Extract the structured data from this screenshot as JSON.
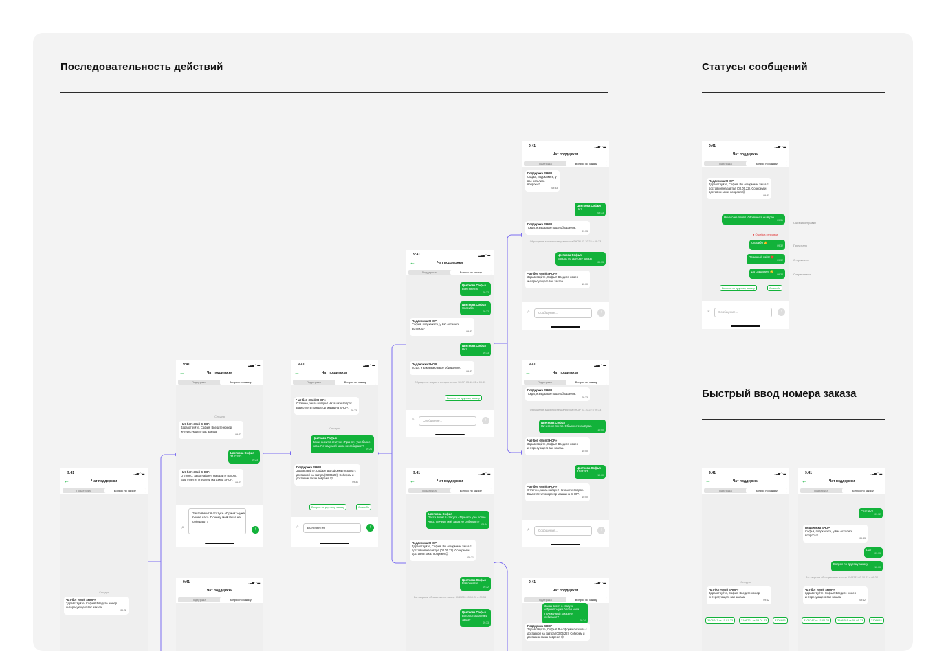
{
  "headings": {
    "sequence": "Последовательность действий",
    "statuses": "Статусы сообщений",
    "quick_input": "Быстрый ввод номера заказа"
  },
  "common": {
    "time": "9:41",
    "chat_title": "Чат поддержки",
    "tab_support": "Поддержка",
    "tab_order": "Вопрос по заказу",
    "placeholder": "Сообщение...",
    "bot": "Чат-бот «Мой SHOP»",
    "support": "Поддержка SHOP",
    "user": "Цветкова Софья",
    "today": "Сегодня",
    "q_other": "Вопрос по другому заказу",
    "thanks": "Спасибо"
  },
  "msgs": {
    "hello_bot": "Здравствуйте, Софья! Введите номер интересующего вас заказа.",
    "bot_found": "Отлично, заказ найден! Наташите вопрос. Вам ответит оператор магазина SHOP.",
    "user_hang": "Заказ висит в статусе «Принят» уже более часа. Почему мой заказ не собирают?",
    "support_hello": "Здравствуйте, Софья! Вы оформили заказ с доставкой на завтра (03.05.22). Соберем и доставим заказ вовремя 😉",
    "understood": "Всё понятно",
    "thanks_msg": "Спасибо!",
    "no": "Нет",
    "any_more": "Софья, подскажите, у вас остались вопросы?",
    "closing": "Тогда, я закрываю ваше обращение.",
    "closed_sys": "Обращение закрыто специалистом SHOP 03.10.22 в 09:33",
    "user_closed_sys": "Вы закрыли обращение по заказу 3143283 03.10.22 в 09:34",
    "not_clear": "Ничего не понял. Объясните ещё раз.",
    "another_order": "Вопрос по другому заказу",
    "order_num": "3143283",
    "order_chip": "3106747 от 11.01.23",
    "order_chip2": "3106701 от 09.01.23",
    "order_chip3": "3106693",
    "like": "Спасибо 👍",
    "nice": "Отличный сайт! ❤️",
    "bye": "До свидания! 🙂",
    "empty_field": "Напишите…"
  },
  "status_labels": {
    "error": "Ошибка отправки",
    "received": "Прочитано",
    "sent": "Отправлено",
    "sending": "Отправляется",
    "error_short": "Ошибка отправки"
  },
  "times": {
    "t1": "09:22",
    "t2": "09:23",
    "t3": "09:24",
    "t4": "09:31",
    "t5": "09:32",
    "t6": "09:33",
    "t7": "10:00",
    "t8": "09:12"
  }
}
